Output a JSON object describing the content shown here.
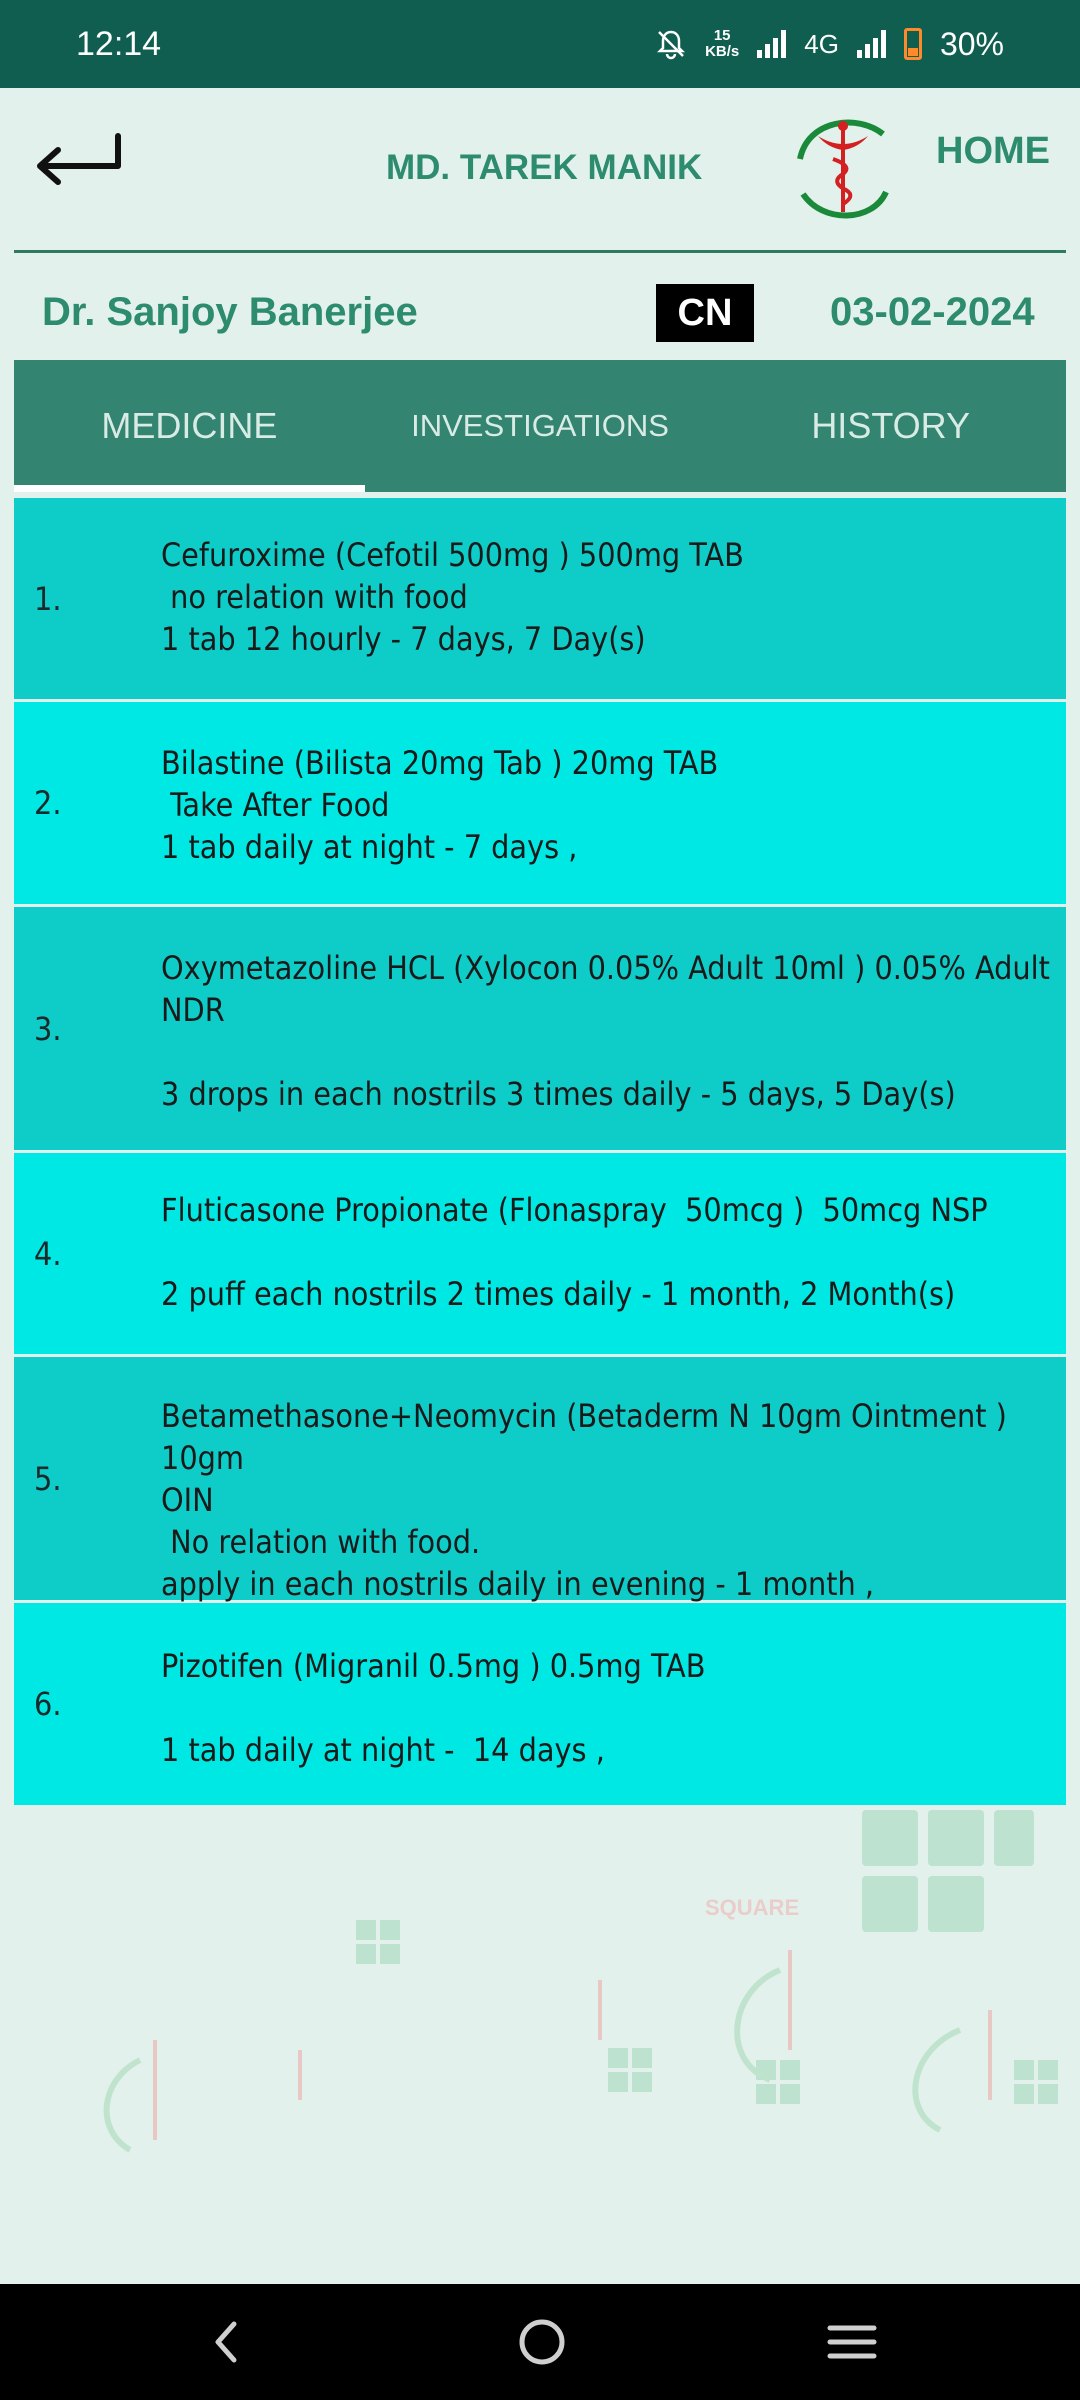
{
  "status_bar": {
    "time": "12:14",
    "net_speed_value": "15",
    "net_speed_unit": "KB/s",
    "network_type": "4G",
    "battery": "30%"
  },
  "header": {
    "patient_name": "MD. TAREK MANIK",
    "home_label": "HOME"
  },
  "info": {
    "doctor_name": "Dr. Sanjoy Banerjee",
    "badge": "CN",
    "date": "03-02-2024"
  },
  "tabs": [
    {
      "label": "MEDICINE",
      "active": true
    },
    {
      "label": "INVESTIGATIONS",
      "active": false
    },
    {
      "label": "HISTORY",
      "active": false
    }
  ],
  "medicines": [
    {
      "num": "1.",
      "text": "Cefuroxime (Cefotil 500mg ) 500mg TAB\n no relation with food\n1 tab 12 hourly - 7 days, 7 Day(s)"
    },
    {
      "num": "2.",
      "text": "Bilastine (Bilista 20mg Tab ) 20mg TAB\n Take After Food\n1 tab daily at night - 7 days ,"
    },
    {
      "num": "3.",
      "text": "Oxymetazoline HCL (Xylocon 0.05% Adult 10ml ) 0.05% Adult\nNDR\n\n3 drops in each nostrils 3 times daily - 5 days, 5 Day(s)"
    },
    {
      "num": "4.",
      "text": "Fluticasone Propionate (Flonaspray  50mcg )  50mcg NSP\n\n2 puff each nostrils 2 times daily - 1 month, 2 Month(s)"
    },
    {
      "num": "5.",
      "text": "Betamethasone+Neomycin (Betaderm N 10gm Ointment ) 10gm\nOIN\n No relation with food.\napply in each nostrils daily in evening - 1 month ,"
    },
    {
      "num": "6.",
      "text": "Pizotifen (Migranil 0.5mg ) 0.5mg TAB\n\n1 tab daily at night -  14 days ,"
    }
  ],
  "watermark_text": "SQUARE",
  "colors": {
    "status_bar": "#0f5e50",
    "accent_green": "#2d8b6e",
    "tab_bar": "#338470",
    "row_dark": "#0ecdc9",
    "row_light": "#00e8e4",
    "background": "#e2f1ec"
  }
}
